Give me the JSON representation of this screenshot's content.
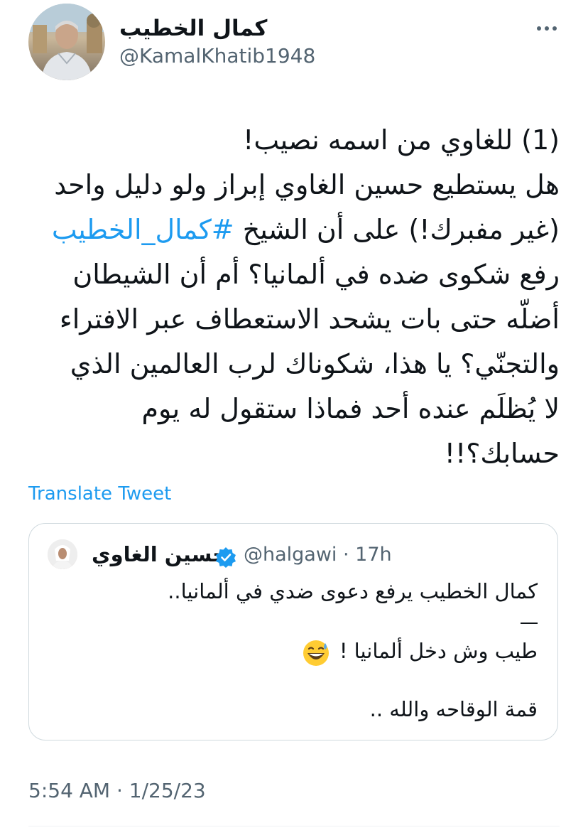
{
  "author": {
    "name": "كمال الخطيب",
    "handle": "@KamalKhatib1948"
  },
  "more_icon": "more-horizontal-icon",
  "tweet": {
    "line1": "(1) للغاوي من اسمه نصيب!",
    "line2": "هل يستطيع حسين الغاوي إبراز ولو دليل واحد",
    "line3_pre": "(غير مفبرك!) على أن الشيخ",
    "hashtag": "#كمال_الخطيب",
    "line4": "رفع شكوى ضده في ألمانيا؟ أم أن الشيطان",
    "line5": "أضلّه حتى بات يشحد الاستعطاف عبر الافتراء",
    "line6": "والتجنّي؟ يا هذا، شكوناك لرب العالمين الذي",
    "line7": "لا يُظلَم عنده أحد فماذا ستقول له يوم",
    "line8": "حسابك؟!!"
  },
  "translate_label": "Translate Tweet",
  "quote": {
    "name": "حسين الغاوي",
    "verified_icon": "verified-badge-icon",
    "handle_time": "@halgawi · 17h",
    "line1": "كمال الخطيب يرفع دعوى ضدي في ألمانيا..",
    "line3": "طيب وش دخل ألمانيا !",
    "emoji": "grinning-sweat-emoji",
    "line4": "قمة الوقاحه والله .."
  },
  "timestamp": "5:54 AM · 1/25/23",
  "colors": {
    "accent": "#1d9bf0",
    "text": "#0f1419",
    "secondary": "#536471",
    "border": "#cfd9de"
  }
}
